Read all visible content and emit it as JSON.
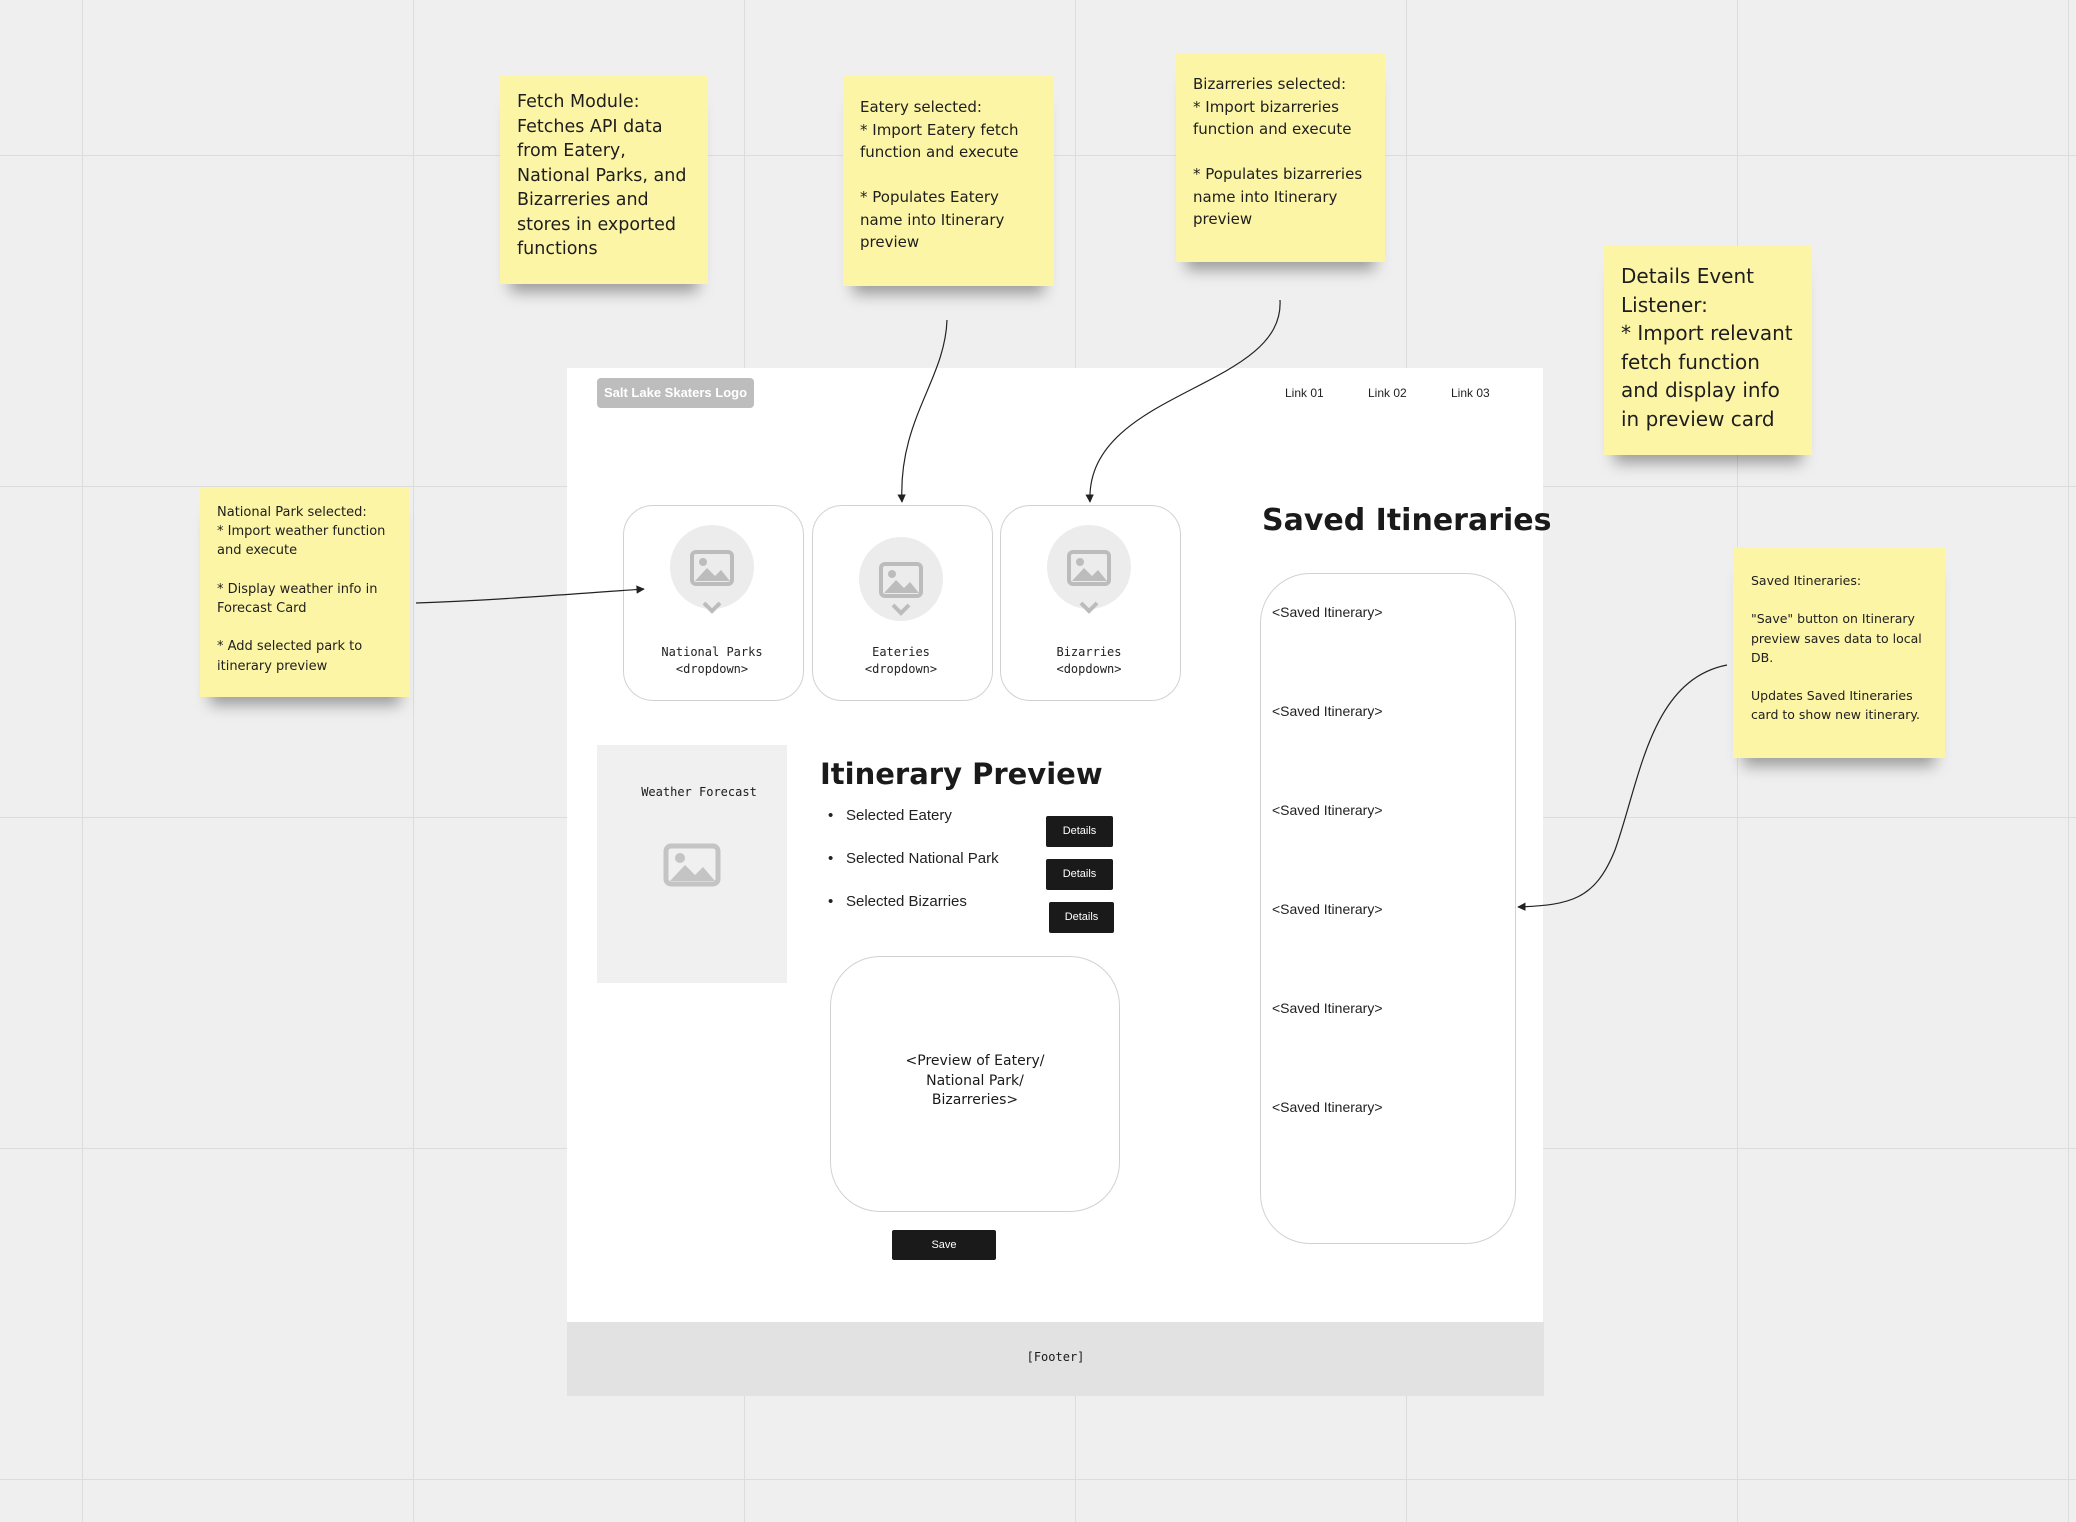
{
  "stickies": {
    "fetch_module": "Fetch Module:\nFetches API data from Eatery, National Parks, and Bizarreries and stores in exported functions",
    "eatery_selected": "Eatery selected:\n* Import Eatery fetch function and execute\n\n* Populates Eatery name into Itinerary preview",
    "bizarreries_selected": "Bizarreries selected:\n* Import bizarreries function and execute\n\n* Populates bizarreries name into Itinerary preview",
    "details_listener": "Details Event Listener:\n * Import relevant fetch function and display info in preview card",
    "national_park_selected": "National Park selected:\n* Import weather function and execute\n\n* Display weather info in Forecast Card\n\n* Add selected park to itinerary preview",
    "saved_itineraries_note": "Saved Itineraries:\n\n\"Save\" button on Itinerary preview saves data to local DB.\n\nUpdates Saved Itineraries card to show new itinerary."
  },
  "wireframe": {
    "logo": "Salt Lake Skaters Logo",
    "nav_links": [
      "Link 01",
      "Link 02",
      "Link 03"
    ],
    "cards": [
      {
        "title": "National Parks",
        "sub": "<dropdown>"
      },
      {
        "title": "Eateries",
        "sub": "<dropdown>"
      },
      {
        "title": "Bizarries",
        "sub": "<dopdown>"
      }
    ],
    "weather_title": "Weather Forecast",
    "itinerary_title": "Itinerary Preview",
    "itinerary_items": [
      "Selected Eatery",
      "Selected National Park",
      "Selected Bizarries"
    ],
    "details_label": "Details",
    "preview_text": "<Preview of Eatery/\nNational Park/\nBizarreries>",
    "save_label": "Save",
    "saved_title": "Saved Itineraries",
    "saved_items": [
      "<Saved Itinerary>",
      "<Saved Itinerary>",
      "<Saved Itinerary>",
      "<Saved Itinerary>",
      "<Saved Itinerary>",
      "<Saved Itinerary>"
    ],
    "footer": "[Footer]"
  },
  "colors": {
    "sticky": "#fdf5a6",
    "canvas": "#efefef",
    "button": "#1a1a1a"
  }
}
